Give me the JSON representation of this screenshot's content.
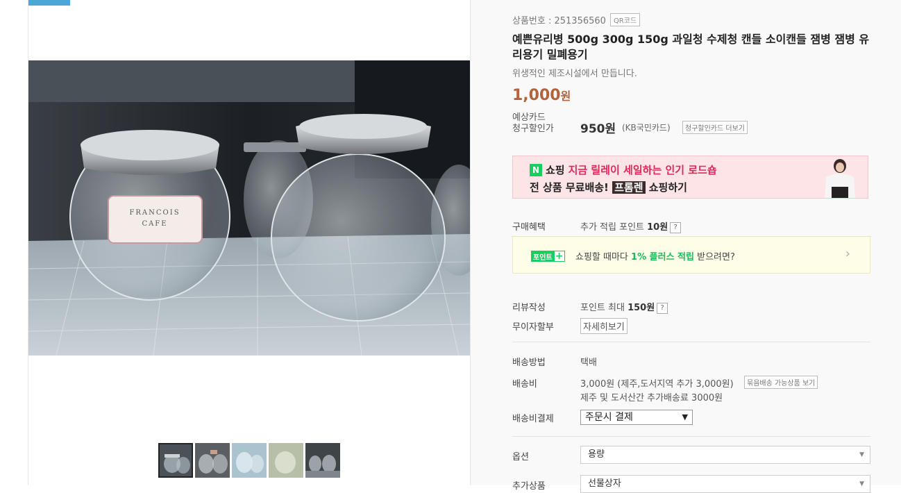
{
  "product": {
    "id_label": "상품번호 : 251356560",
    "qr_label": "QR코드",
    "title": "예쁜유리병 500g 300g 150g 과일청 수제청 캔들 소이캔들 잼병 잼병 유리용기 밀폐용기",
    "subtitle": "위생적인 제조시설에서 만듭니다.",
    "price": "1,000",
    "price_unit": "원",
    "label_text_on_jar": "FRANCOIS CAFE"
  },
  "card_discount": {
    "label_line1": "예상카드",
    "label_line2": "청구할인가",
    "price": "950원",
    "card_name": "(KB국민카드)",
    "more_button": "청구할인카드 더보기"
  },
  "banner": {
    "shop_word": "쇼핑",
    "line1": "지금 릴레이 세일하는 인기 로드숍",
    "line2_prefix": "전 상품 무료배송!",
    "brand": "프롬렌",
    "line2_suffix": " 쇼핑하기",
    "n_logo": "N"
  },
  "benefit": {
    "label": "구매혜택",
    "value_prefix": "추가 적립 포인트",
    "value_bold": "10원",
    "help": "?"
  },
  "point_box": {
    "badge": "포인트",
    "badge_plus": "+",
    "text_prefix": "쇼핑할 때마다",
    "text_bold": "1% 플러스 적립",
    "text_suffix": "받으려면?",
    "arrow": "›",
    "accent_color": "#19ce60"
  },
  "review": {
    "label": "리뷰작성",
    "value_prefix": "포인트 최대",
    "value_bold": "150원",
    "help": "?"
  },
  "installment": {
    "label": "무이자할부",
    "button": "자세히보기"
  },
  "shipping": {
    "method_label": "배송방법",
    "method_value": "택배",
    "fee_label": "배송비",
    "fee_value": "3,000원 (제주,도서지역 추가 3,000원)",
    "bundle_button": "묶음배송 가능상품 보기",
    "fee_note": "제주 및 도서산간 추가배송료 3000원",
    "payment_label": "배송비결제",
    "payment_value": "주문시 결제",
    "payment_arrow": "▼"
  },
  "options": {
    "label": "옵션",
    "value": "용량",
    "arrow": "▼"
  },
  "addon": {
    "label": "추가상품",
    "value": "선물상자",
    "arrow": "▼"
  },
  "colors": {
    "price": "#b0633d",
    "banner_pink": "#e0285a",
    "tab_accent": "#4aa7d6"
  }
}
